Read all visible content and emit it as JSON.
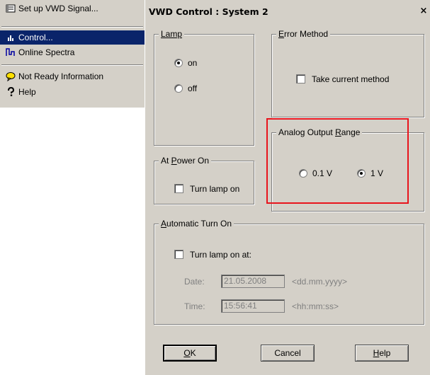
{
  "menu": {
    "items": [
      {
        "label": "Set up VWD Signal...",
        "icon": "signal-setup-icon"
      },
      {
        "label": "Control...",
        "icon": "control-icon",
        "highlighted": true
      },
      {
        "label": "Online Spectra",
        "icon": "spectra-icon"
      },
      {
        "label": "Not Ready Information",
        "icon": "not-ready-icon"
      },
      {
        "label": "Help",
        "icon": "help-icon"
      }
    ]
  },
  "dialog": {
    "title": "VWD Control : System 2",
    "close_glyph": "×",
    "lamp": {
      "label": "Lamp",
      "options": [
        {
          "label": "on",
          "checked": true
        },
        {
          "label": "off",
          "checked": false
        }
      ]
    },
    "error_method": {
      "label_prefix": "E",
      "label_rest": "rror Method",
      "checkbox_label": "Take current method",
      "checked": false
    },
    "analog_output": {
      "label": "Analog Output ",
      "label_underlined": "R",
      "label_rest": "ange",
      "options": [
        {
          "label": "0.1 V",
          "checked": false
        },
        {
          "label": "1 V",
          "checked": true
        }
      ],
      "highlight_color": "#e8141c"
    },
    "at_power_on": {
      "label_pre": "At ",
      "label_underlined": "P",
      "label_rest": "ower On",
      "checkbox_label": "Turn lamp on",
      "checked": false
    },
    "automatic_turn_on": {
      "label_underlined": "A",
      "label_rest": "utomatic Turn On",
      "checkbox_label": "Turn lamp on at:",
      "checked": false,
      "date_label": "Date:",
      "date_value": "21.05.2008",
      "date_format": "<dd.mm.yyyy>",
      "time_label": "Time:",
      "time_value": "15:56:41",
      "time_format": "<hh:mm:ss>"
    },
    "buttons": {
      "ok_underlined": "O",
      "ok_rest": "K",
      "cancel": "Cancel",
      "help_underlined": "H",
      "help_rest": "elp"
    }
  }
}
